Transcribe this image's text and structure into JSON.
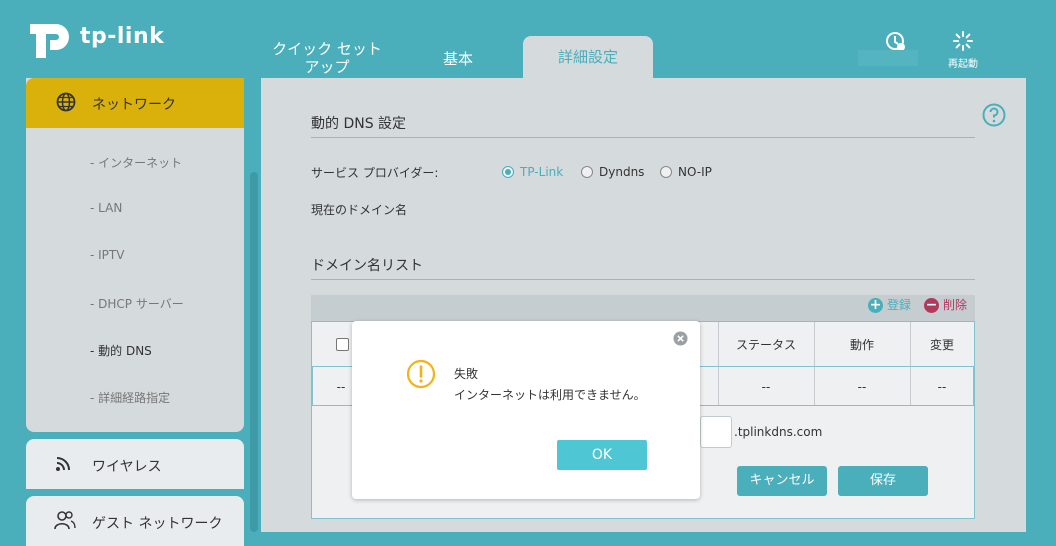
{
  "header": {
    "logo_text": "tp-link",
    "tabs": [
      {
        "label_line1": "クイック セット",
        "label_line2": "アップ"
      },
      {
        "label": "基本"
      },
      {
        "label": "詳細設定"
      }
    ],
    "reboot_label": "再起動"
  },
  "sidebar": {
    "network_label": "ネットワーク",
    "subitems": [
      "- インターネット",
      "- LAN",
      "- IPTV",
      "- DHCP サーバー",
      "- 動的 DNS",
      "- 詳細経路指定"
    ],
    "wireless_label": "ワイヤレス",
    "guest_label": "ゲスト ネットワーク"
  },
  "main": {
    "dns_title": "動的 DNS 設定",
    "provider_label": "サービス プロバイダー:",
    "providers": [
      "TP-Link",
      "Dyndns",
      "NO-IP"
    ],
    "selected_provider": "TP-Link",
    "current_domain_label": "現在のドメイン名",
    "domain_list_title": "ドメイン名リスト",
    "add_label": "登録",
    "delete_label": "削除",
    "columns": [
      "ステータス",
      "動作",
      "変更"
    ],
    "row_values": [
      "--",
      "--",
      "--",
      "--"
    ],
    "domain_suffix": ".tplinkdns.com",
    "cancel_label": "キャンセル",
    "save_label": "保存"
  },
  "dialog": {
    "title": "失敗",
    "message": "インターネットは利用できません。",
    "ok_label": "OK"
  },
  "colors": {
    "teal": "#4aaebb",
    "active_yellow": "#d9b10a",
    "panel": "#d5dadc",
    "delete_red": "#b0395c",
    "warning": "#f3b219"
  }
}
